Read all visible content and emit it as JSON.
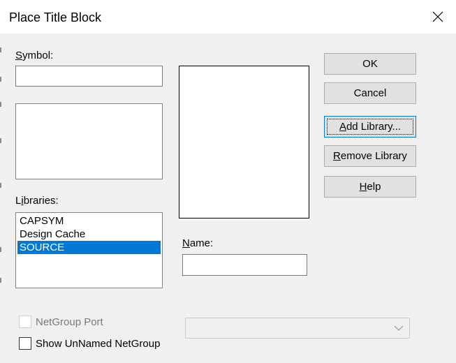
{
  "window": {
    "title": "Place Title Block",
    "close_icon": "close-icon"
  },
  "symbol": {
    "label_accel": "S",
    "label_rest": "ymbol:",
    "value": ""
  },
  "libraries": {
    "label_accel": "i",
    "label_pre": "L",
    "label_rest": "braries:",
    "items": [
      "CAPSYM",
      "Design Cache",
      "SOURCE"
    ],
    "selected_index": 2
  },
  "name": {
    "label_accel": "N",
    "label_rest": "ame:",
    "value": ""
  },
  "buttons": {
    "ok": {
      "label": "OK"
    },
    "cancel": {
      "label": "Cancel"
    },
    "add_library": {
      "accel": "A",
      "rest": "dd Library..."
    },
    "remove_library": {
      "accel": "R",
      "rest": "emove Library"
    },
    "help": {
      "accel": "H",
      "rest": "elp"
    }
  },
  "checkboxes": {
    "netgroup_port": {
      "label": "NetGroup Port",
      "checked": false,
      "enabled": false
    },
    "show_unnamed": {
      "label": "Show UnNamed NetGroup",
      "checked": false,
      "enabled": true
    }
  },
  "netgroup_select": {
    "value": "",
    "enabled": false,
    "icon": "chevron-down-icon"
  },
  "colors": {
    "dialog_bg": "#f0f0f0",
    "selection": "#0078d7",
    "button_bg": "#e1e1e1"
  }
}
